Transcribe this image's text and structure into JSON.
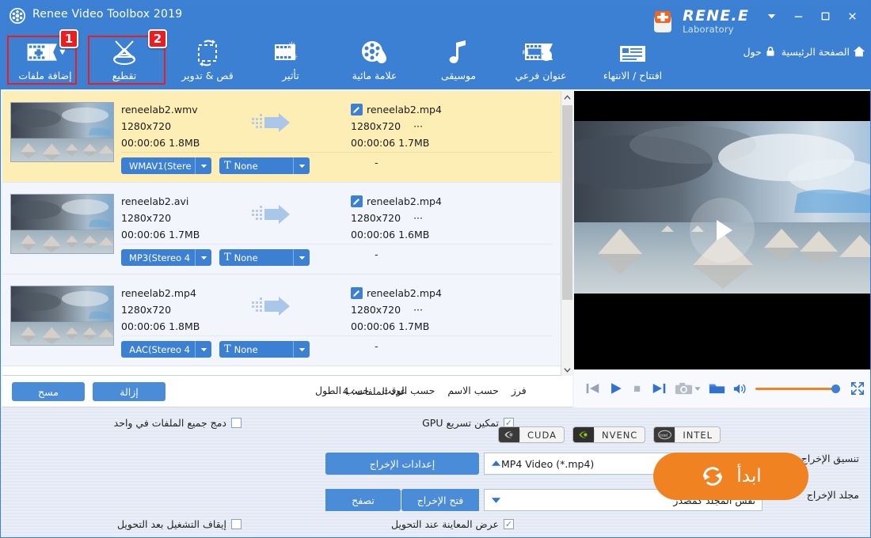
{
  "window": {
    "title": "Renee Video Toolbox 2019",
    "brand_main": "RENE.E",
    "brand_sub": "Laboratory",
    "minimize": "−",
    "maximize": "□",
    "close": "✕",
    "menu_caret": "▾"
  },
  "toolbar": {
    "items": [
      {
        "label": "إضافة ملفات",
        "icon": "add-files-icon",
        "badge": "1"
      },
      {
        "label": "تقطيع",
        "icon": "scissors-icon",
        "badge": "2"
      },
      {
        "label": "قص & تدوير",
        "icon": "crop-rotate-icon",
        "badge": ""
      },
      {
        "label": "تأثير",
        "icon": "effect-icon",
        "badge": ""
      },
      {
        "label": "علامة مائية",
        "icon": "watermark-icon",
        "badge": ""
      },
      {
        "label": "موسيقى",
        "icon": "music-note-icon",
        "badge": ""
      },
      {
        "label": "عنوان فرعي",
        "icon": "subtitle-icon",
        "badge": ""
      },
      {
        "label": "افتتاح / الانتهاء",
        "icon": "intro-outro-icon",
        "badge": ""
      }
    ],
    "links": [
      {
        "label": "الصفحة الرئيسية",
        "icon": "home-icon"
      },
      {
        "label": "حول",
        "icon": "lock-icon"
      }
    ]
  },
  "filelist": {
    "rows": [
      {
        "selected": true,
        "source": {
          "name": "reneelab2.wmv",
          "resolution": "1280x720",
          "meta": "00:00:06  1.8MB"
        },
        "output": {
          "name": "reneelab2.mp4",
          "resolution": "1280x720",
          "ellipsis": "···",
          "meta": "00:00:06  1.7MB"
        },
        "audio": "WMAV1(Stere",
        "subtitle": "None",
        "extra": "-"
      },
      {
        "selected": false,
        "source": {
          "name": "reneelab2.avi",
          "resolution": "1280x720",
          "meta": "00:00:06  1.7MB"
        },
        "output": {
          "name": "reneelab2.mp4",
          "resolution": "1280x720",
          "ellipsis": "···",
          "meta": "00:00:06  1.6MB"
        },
        "audio": "MP3(Stereo 4",
        "subtitle": "None",
        "extra": "-"
      },
      {
        "selected": false,
        "source": {
          "name": "reneelab2.mp4",
          "resolution": "1280x720",
          "meta": "00:00:06  1.8MB"
        },
        "output": {
          "name": "reneelab2.mp4",
          "resolution": "1280x720",
          "ellipsis": "···",
          "meta": "00:00:06  1.7MB"
        },
        "audio": "AAC(Stereo 4",
        "subtitle": "None",
        "extra": "-"
      }
    ]
  },
  "listfooter": {
    "clear_label": "مسح",
    "remove_label": "إزالة",
    "count_text": "عدد الملفات: 4",
    "sort_label": "فرز",
    "sort_options": [
      "حسب الاسم",
      "حسب الوقت",
      "حسب الطول"
    ]
  },
  "player": {
    "prev": "skip-previous-icon",
    "play": "play-icon",
    "stop": "stop-icon",
    "next": "skip-next-icon",
    "snapshot": "camera-icon",
    "folder": "folder-icon",
    "volume": "volume-icon",
    "fullscreen": "fullscreen-icon",
    "volume_level": "100"
  },
  "settings": {
    "merge_label": "دمج جميع الملفات في واحد",
    "merge_checked": false,
    "gpu_label": "تمكين تسريع GPU",
    "gpu_checked": true,
    "gpu_chips": [
      {
        "name": "CUDA",
        "icon": "nvidia-icon",
        "enabled": true
      },
      {
        "name": "NVENC",
        "icon": "nvidia-green-icon",
        "enabled": true
      },
      {
        "name": "INTEL",
        "icon": "intel-icon",
        "enabled": true
      }
    ],
    "format_label": "تنسيق الإخراج",
    "format_value": "MP4 Video (*.mp4)",
    "folder_label": "مجلد الإخراج",
    "folder_value": "نفس المجلد كمصدر",
    "output_settings_btn": "إعدادات الإخراج",
    "open_output_btn": "فتح الإخراج",
    "browse_btn": "تصفح",
    "shutdown_label": "إيقاف التشغيل بعد التحويل",
    "shutdown_checked": false,
    "preview_label": "عرض المعاينة عند التحويل",
    "preview_checked": true,
    "start_label": "ابدأ"
  },
  "colors": {
    "header_blue": "#3c80d4",
    "accent_orange": "#f08221",
    "selected_row": "#fdeeb5",
    "highlight_red": "#ee1c1c"
  }
}
